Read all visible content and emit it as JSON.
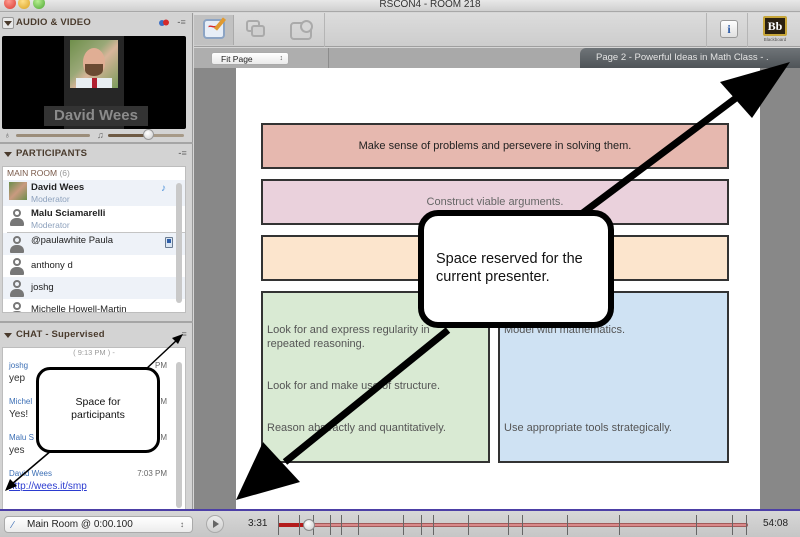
{
  "window": {
    "title": "RSCON4 - ROOM 218"
  },
  "audio_video": {
    "header": "AUDIO & VIDEO",
    "menu_glyph": "-≡",
    "video_name": "David Wees",
    "mic_glyph": "♁",
    "speaker_glyph": "♫",
    "speaker_volume_fraction": 0.52
  },
  "participants": {
    "header": "PARTICIPANTS",
    "menu_glyph": "-≡",
    "room_label": "MAIN ROOM",
    "room_count": "(6)",
    "items": [
      {
        "name": "David Wees",
        "role": "Moderator",
        "photo": true,
        "indicator": "microphone-active"
      },
      {
        "name": "Malu Sciamarelli",
        "role": "Moderator",
        "photo": false,
        "indicator": ""
      },
      {
        "name": "@paulawhite Paula",
        "role": "",
        "photo": false,
        "indicator": "mobile-device"
      },
      {
        "name": "anthony d",
        "role": "",
        "photo": false,
        "indicator": ""
      },
      {
        "name": "joshg",
        "role": "",
        "photo": false,
        "indicator": ""
      },
      {
        "name": "Michelle Howell-Martin",
        "role": "",
        "photo": false,
        "indicator": ""
      }
    ],
    "mic_glyph": "♪"
  },
  "chat": {
    "header": "CHAT - Supervised",
    "menu_glyph": "≡",
    "time_separator": "( 9:13 PM ) -",
    "messages": [
      {
        "author": "joshg",
        "time": "PM",
        "text": "yep",
        "is_link": false
      },
      {
        "author": "Michel",
        "time": "M",
        "text": "Yes!",
        "is_link": false
      },
      {
        "author": "Malu S",
        "time": "M",
        "text": "yes",
        "is_link": false
      },
      {
        "author": "David Wees",
        "time": "7:03 PM",
        "text": "http://wees.it/smp",
        "is_link": true
      }
    ]
  },
  "toolbar": {
    "info_label": "i",
    "blackboard_logo": "Bb",
    "blackboard_label": "Blackboard"
  },
  "document": {
    "zoom_select": "Fit Page",
    "updown_glyph": "↕",
    "page_label": "Page 2 - Powerful Ideas in Math Class - .",
    "boxes": {
      "b1": "Make sense of problems and persevere in solving them.",
      "b2": "Construct viable arguments.",
      "b4_lines": [
        "Look for and express regularity in",
        "repeated reasoning.",
        "Look for and make use of structure.",
        "Reason abstractly and quantitatively."
      ],
      "b5_lines": [
        "Model with mathematics.",
        "Use appropriate tools strategically."
      ]
    }
  },
  "annotations": {
    "presenter_callout": [
      "Space reserved for the",
      "current presenter."
    ],
    "participants_callout": [
      "Space for",
      "participants"
    ]
  },
  "playback": {
    "room_select": "Main Room @ 0:00.100",
    "pen_glyph": "∕",
    "updown_glyph": "↕",
    "current_time": "3:31",
    "end_time": "54:08",
    "progress_fraction": 0.065,
    "marker_fractions": [
      0.0,
      0.045,
      0.075,
      0.11,
      0.135,
      0.17,
      0.265,
      0.305,
      0.33,
      0.405,
      0.49,
      0.52,
      0.615,
      0.725,
      0.89,
      0.995,
      0.965
    ]
  }
}
